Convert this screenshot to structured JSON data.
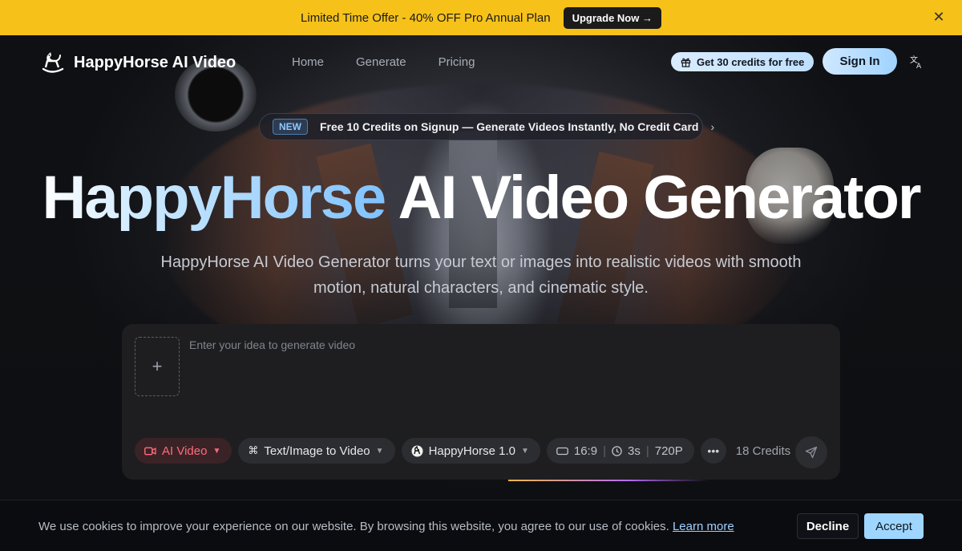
{
  "promo": {
    "text": "Limited Time Offer - 40% OFF Pro Annual Plan",
    "button": "Upgrade Now →",
    "close_icon": "close-icon"
  },
  "nav": {
    "brand": "HappyHorse AI Video",
    "links": [
      "Home",
      "Generate",
      "Pricing"
    ],
    "credits_pill": "Get 30 credits for free",
    "sign_in": "Sign In",
    "language_icon": "translate-icon"
  },
  "badge": {
    "tag": "NEW",
    "text": "Free 10 Credits on Signup — Generate Videos Instantly, No Credit Card"
  },
  "hero": {
    "title_part1": "HappyHorse",
    "title_part2": " AI Video Generator",
    "subtitle": "HappyHorse AI Video Generator turns your text or images into realistic videos with smooth motion, natural characters, and cinematic style."
  },
  "generator": {
    "placeholder": "Enter your idea to generate video",
    "upload_icon": "+",
    "mode": "AI Video",
    "input_type": "Text/Image to Video",
    "model": "HappyHorse 1.0",
    "aspect_ratio": "16:9",
    "duration": "3s",
    "resolution": "720P",
    "credits": "18 Credits"
  },
  "cookie": {
    "text": "We use cookies to improve your experience on our website. By browsing this website, you agree to our use of cookies.",
    "link": "Learn more",
    "decline": "Decline",
    "accept": "Accept"
  },
  "colors": {
    "promo_bg": "#f6c21a",
    "accent": "#9fd6ff",
    "mode_red": "#ff6b7a"
  }
}
